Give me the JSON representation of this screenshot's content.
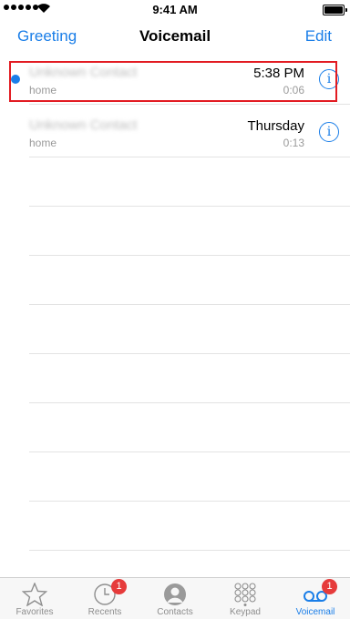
{
  "status_bar": {
    "time": "9:41 AM"
  },
  "nav": {
    "left": "Greeting",
    "title": "Voicemail",
    "right": "Edit"
  },
  "voicemails": [
    {
      "name": "Unknown Contact",
      "label": "home",
      "time": "5:38 PM",
      "duration": "0:06",
      "unread": true,
      "highlighted": true
    },
    {
      "name": "Unknown Contact",
      "label": "home",
      "time": "Thursday",
      "duration": "0:13",
      "unread": false,
      "highlighted": false
    }
  ],
  "tabs": [
    {
      "label": "Favorites",
      "icon": "star-icon"
    },
    {
      "label": "Recents",
      "icon": "clock-icon",
      "badge": "1"
    },
    {
      "label": "Contacts",
      "icon": "contact-icon"
    },
    {
      "label": "Keypad",
      "icon": "keypad-icon"
    },
    {
      "label": "Voicemail",
      "icon": "voicemail-icon",
      "badge": "1",
      "active": true
    }
  ],
  "colors": {
    "accent": "#1a7ee8",
    "highlight": "#e21b22",
    "badge": "#e63b3b"
  }
}
